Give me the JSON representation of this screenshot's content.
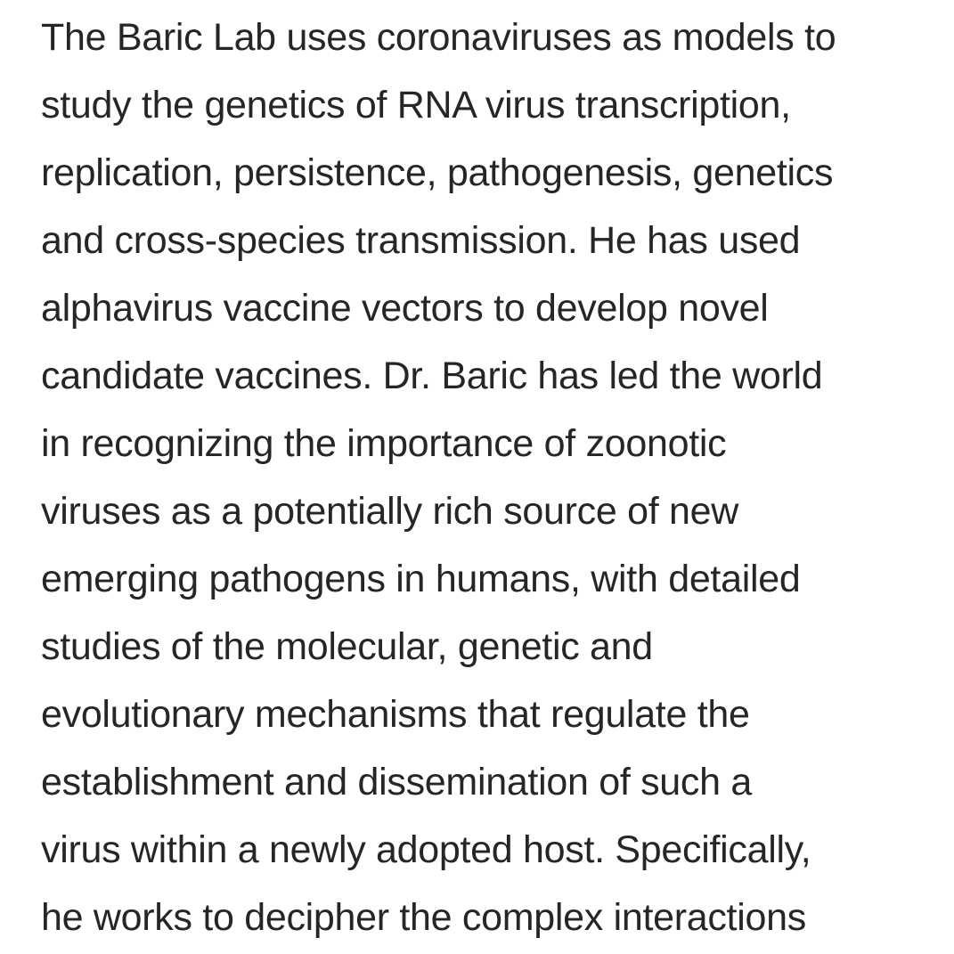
{
  "paragraph": {
    "lines": [
      "The Baric Lab uses coronaviruses as models to",
      "study the genetics of RNA virus transcription,",
      "replication, persistence, pathogenesis, genetics",
      "and cross-species transmission. He has used",
      "alphavirus vaccine vectors to develop novel",
      "candidate vaccines. Dr. Baric has led the world",
      "in recognizing the importance of zoonotic",
      "viruses as a potentially rich source of new",
      "emerging pathogens in humans, with detailed",
      "studies of the molecular, genetic and",
      "evolutionary mechanisms that regulate the",
      "establishment and dissemination of such a",
      "virus within a newly adopted host. Specifically,",
      "he works to decipher the complex interactions"
    ]
  }
}
